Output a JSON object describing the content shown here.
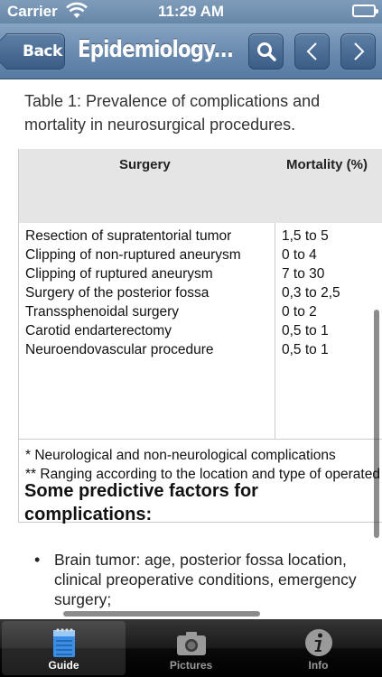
{
  "status_bar": {
    "carrier": "Carrier",
    "time": "11:29 AM"
  },
  "nav_bar": {
    "back_label": "Back",
    "title": "Epidemiology...",
    "buttons": [
      "search-icon",
      "chevron-left-icon",
      "chevron-right-icon"
    ]
  },
  "content": {
    "caption": "Table 1: Prevalence of complications and mortality in neurosurgical procedures.",
    "table": {
      "headers": [
        "Surgery",
        "Mortality (%)"
      ],
      "rows": [
        [
          "Resection of supratentorial tumor",
          "1,5 to 5"
        ],
        [
          "Clipping of non-ruptured aneurysm",
          "0 to 4"
        ],
        [
          "Clipping of ruptured aneurysm",
          "7 to 30"
        ],
        [
          "Surgery of the posterior fossa",
          "0,3 to 2,5"
        ],
        [
          "Transsphenoidal surgery",
          "0 to 2"
        ],
        [
          "Carotid endarterectomy",
          "0,5 to 1"
        ],
        [
          "Neuroendovascular procedure",
          "0,5 to 1"
        ]
      ],
      "notes": [
        "* Neurological and non-neurological complications",
        "** Ranging according to the location and type of operated"
      ]
    },
    "section_heading": "Some predictive factors for complications:",
    "bullets": [
      "Brain tumor: age, posterior fossa location, clinical preoperative conditions, emergency surgery;"
    ]
  },
  "tab_bar": {
    "tabs": [
      {
        "label": "Guide",
        "icon": "notepad-icon",
        "active": true
      },
      {
        "label": "Pictures",
        "icon": "camera-icon",
        "active": false
      },
      {
        "label": "Info",
        "icon": "info-icon",
        "active": false
      }
    ]
  },
  "colors": {
    "nav_bar": "#6b8cb0",
    "table_header": "#e5e5e5",
    "tab_bar": "#000000"
  }
}
